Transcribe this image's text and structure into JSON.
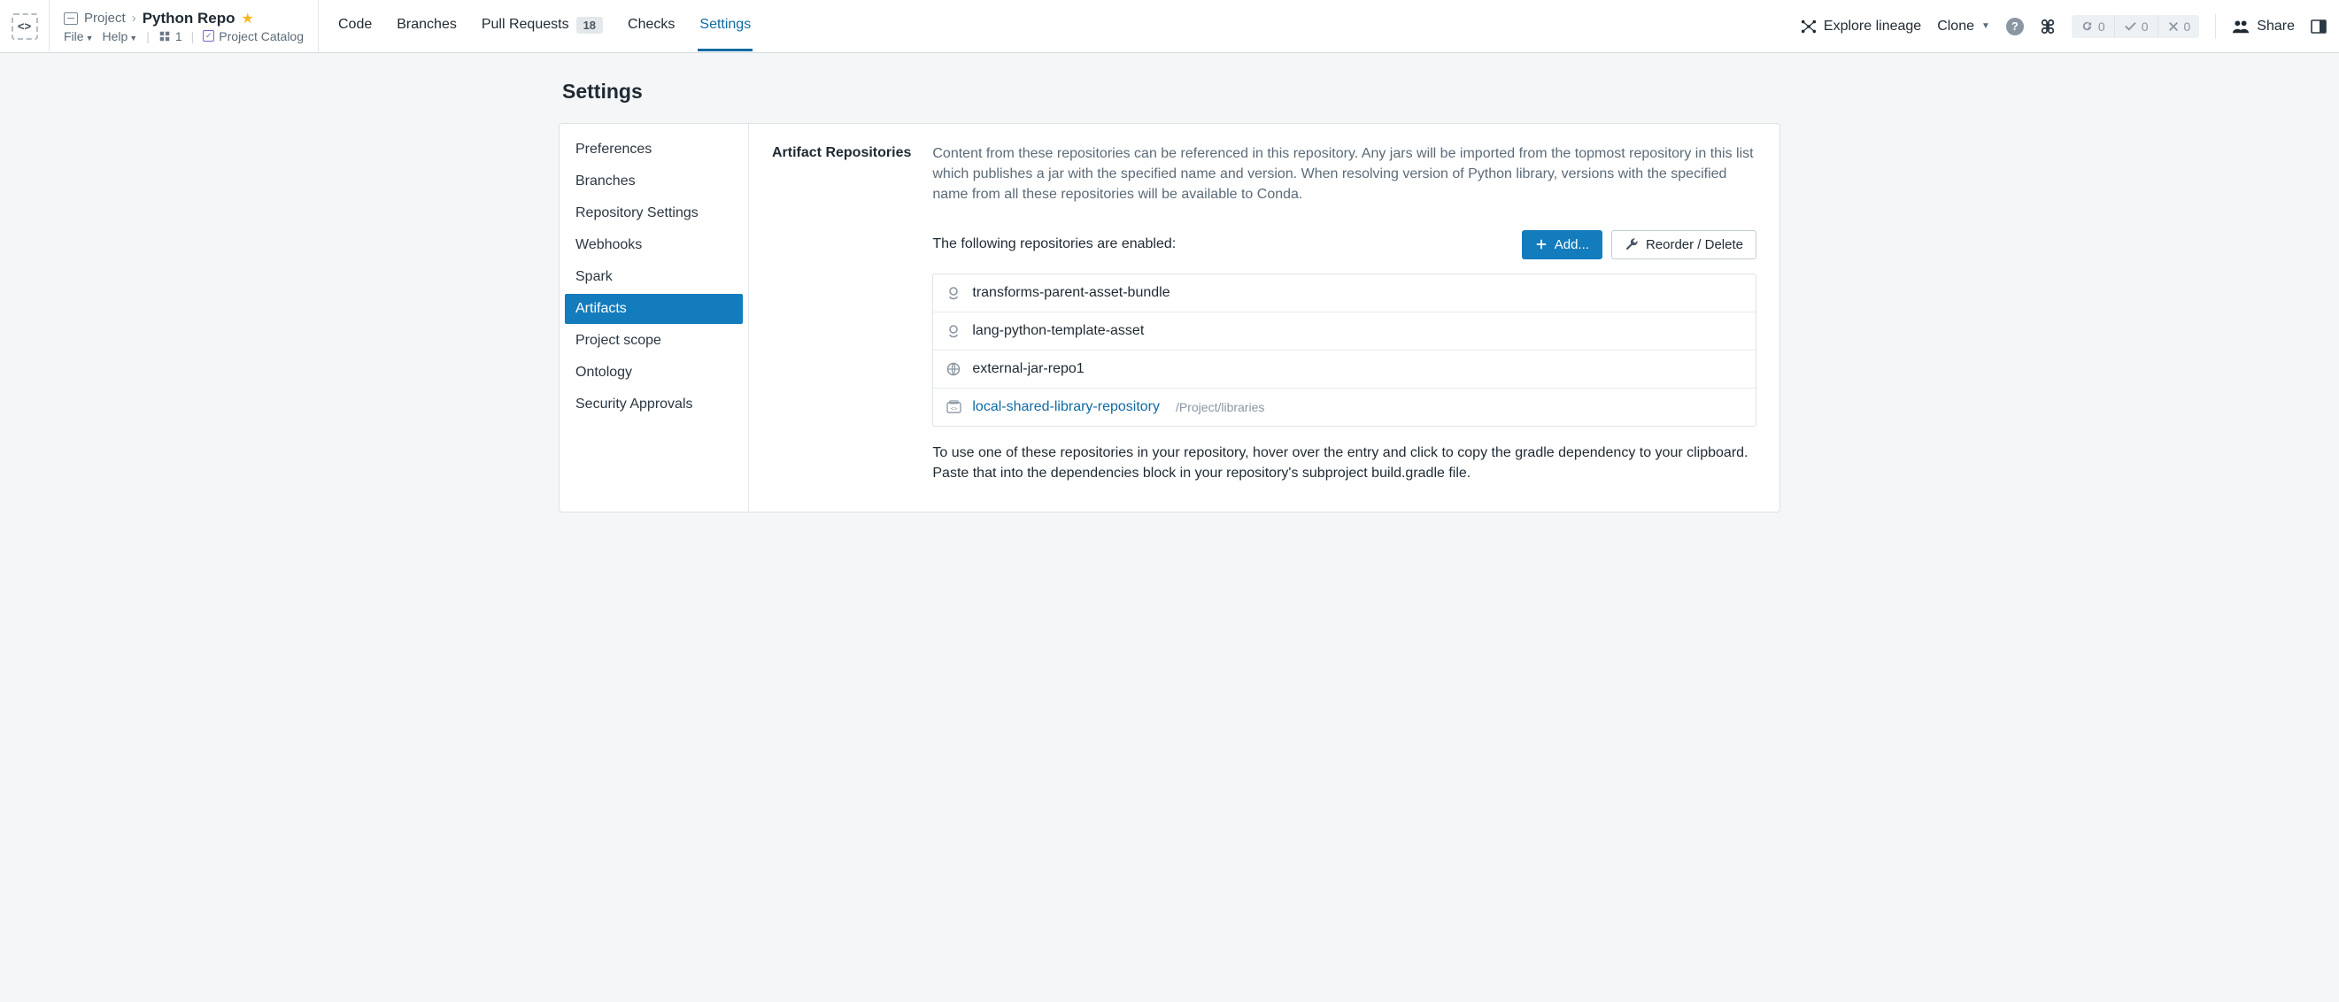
{
  "breadcrumb": {
    "project": "Project",
    "repo": "Python Repo"
  },
  "file_menu": "File",
  "help_menu": "Help",
  "branch_count": "1",
  "project_catalog": "Project Catalog",
  "tabs": {
    "code": "Code",
    "branches": "Branches",
    "pull_requests": "Pull Requests",
    "pr_badge": "18",
    "checks": "Checks",
    "settings": "Settings"
  },
  "right": {
    "explore_lineage": "Explore lineage",
    "clone": "Clone",
    "share": "Share",
    "status_sync": "0",
    "status_ok": "0",
    "status_err": "0"
  },
  "page_title": "Settings",
  "sidebar": {
    "items": [
      {
        "label": "Preferences"
      },
      {
        "label": "Branches"
      },
      {
        "label": "Repository Settings"
      },
      {
        "label": "Webhooks"
      },
      {
        "label": "Spark"
      },
      {
        "label": "Artifacts"
      },
      {
        "label": "Project scope"
      },
      {
        "label": "Ontology"
      },
      {
        "label": "Security Approvals"
      }
    ]
  },
  "content": {
    "section_title": "Artifact Repositories",
    "description": "Content from these repositories can be referenced in this repository. Any jars will be imported from the topmost repository in this list which publishes a jar with the specified name and version. When resolving version of Python library, versions with the specified name from all these repositories will be available to Conda.",
    "enabled_text": "The following repositories are enabled:",
    "add_btn": "Add...",
    "reorder_btn": "Reorder / Delete",
    "repos": [
      {
        "icon": "package",
        "name": "transforms-parent-asset-bundle",
        "link": false,
        "path": ""
      },
      {
        "icon": "package",
        "name": "lang-python-template-asset",
        "link": false,
        "path": ""
      },
      {
        "icon": "globe",
        "name": "external-jar-repo1",
        "link": false,
        "path": ""
      },
      {
        "icon": "code",
        "name": "local-shared-library-repository",
        "link": true,
        "path": "/Project/libraries"
      }
    ],
    "footer": "To use one of these repositories in your repository, hover over the entry and click to copy the gradle dependency to your clipboard. Paste that into the dependencies block in your repository's subproject build.gradle file."
  }
}
